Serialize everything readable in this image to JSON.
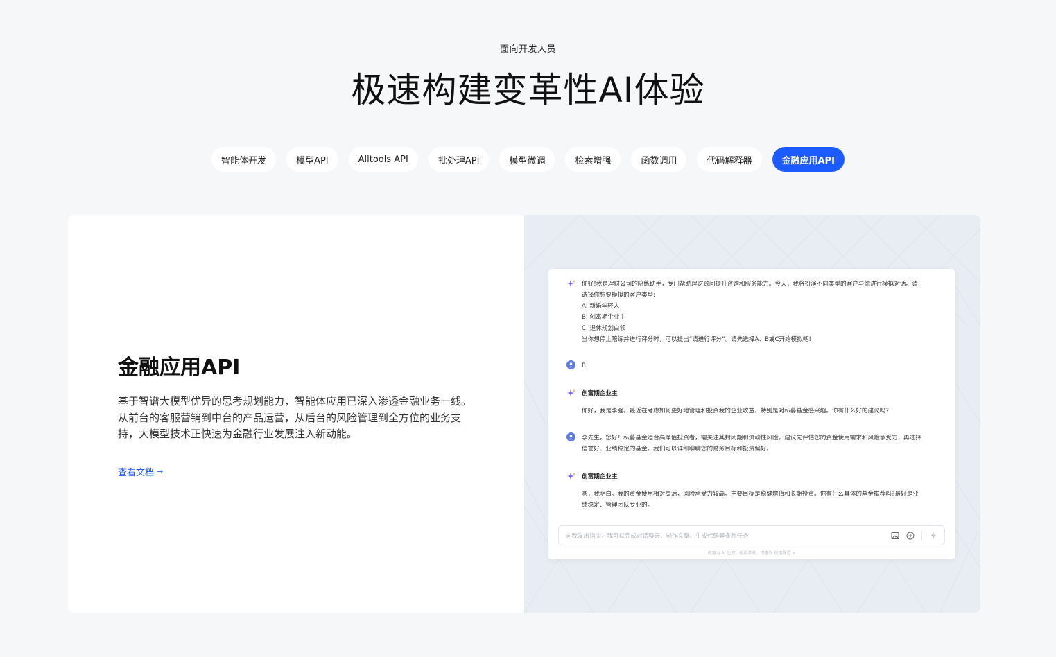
{
  "hero": {
    "eyebrow": "面向开发人员",
    "title": "极速构建变革性AI体验"
  },
  "tabs": [
    {
      "label": "智能体开发",
      "active": false
    },
    {
      "label": "模型API",
      "active": false
    },
    {
      "label": "Alltools API",
      "active": false
    },
    {
      "label": "批处理API",
      "active": false
    },
    {
      "label": "模型微调",
      "active": false
    },
    {
      "label": "检索增强",
      "active": false
    },
    {
      "label": "函数调用",
      "active": false
    },
    {
      "label": "代码解释器",
      "active": false
    },
    {
      "label": "金融应用API",
      "active": true
    }
  ],
  "feature": {
    "title": "金融应用API",
    "description": "基于智谱大模型优异的思考规划能力，智能体应用已深入渗透金融业务一线。从前台的客服营销到中台的产品运营，从后台的风险管理到全方位的业务支持，大模型技术正快速为金融行业发展注入新动能。",
    "link_label": "查看文档",
    "link_arrow": "→"
  },
  "chat": {
    "messages": [
      {
        "role": "assistant",
        "lines": [
          "你好!我是理财公司的陪练助手，专门帮助理财顾问提升咨询和服务能力。今天，我将扮演不同类型的客户与你进行模拟对话。请",
          "选择你想要模拟的客户类型:",
          "A: 新婚年轻人",
          "B: 创富期企业主",
          "C: 退休规划白领",
          "当你想停止陪练并进行评分时，可以提出“请进行评分”。请先选择A、B或C开始模拟吧!"
        ]
      },
      {
        "role": "user",
        "lines": [
          "B"
        ]
      },
      {
        "role": "assistant",
        "name": "创富期企业主",
        "lines": [
          "你好，我是李强。最近在考虑如何更好地管理和投资我的企业收益，特别是对私募基金感兴趣。你有什么好的建议吗?"
        ]
      },
      {
        "role": "user",
        "lines": [
          "李先生，您好！私募基金适合高净值投资者，需关注其封闭期和流动性风险。建议先评估您的资金使用需求和风险承受力，再选择",
          "信誉好、业绩稳定的基金。我们可以详细聊聊您的财务目标和投资偏好。"
        ]
      },
      {
        "role": "assistant",
        "name": "创富期企业主",
        "lines": [
          "嗯，我明白。我的资金使用相对灵活，风险承受力较高。主要目标是稳健增值和长期投资。你有什么具体的基金推荐吗?最好是业",
          "绩稳定、管理团队专业的。"
        ]
      }
    ],
    "input_placeholder": "向我发出指令，我可以完成对话聊天、创作文章、生成代码等多种任务",
    "disclaimer": "内容为 AI 生成，仅供参考，请遵守 使用规范 >"
  },
  "colors": {
    "accent": "#1b5bff",
    "page_bg": "#f6f7f9",
    "panel_bg": "#e8ecf3",
    "avatar": "#5a7bea",
    "sparkle": "#7b5cf0"
  }
}
